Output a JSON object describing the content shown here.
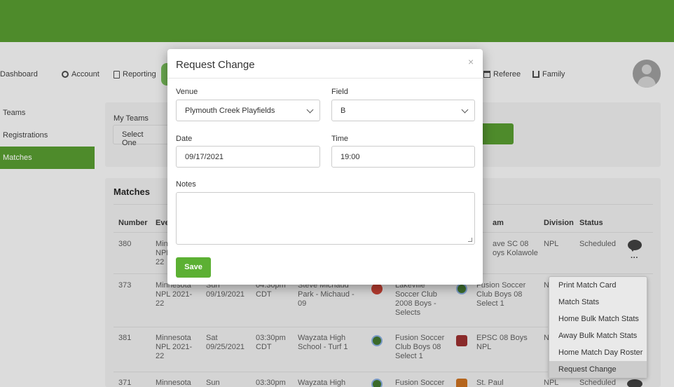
{
  "nav": {
    "dashboard": "Dashboard",
    "account": "Account",
    "reporting": "Reporting",
    "referee": "Referee",
    "family": "Family"
  },
  "sidebar": {
    "items": [
      {
        "label": "Teams"
      },
      {
        "label": "Registrations"
      },
      {
        "label": "Matches"
      }
    ]
  },
  "filters": {
    "my_teams_label": "My Teams",
    "my_teams_value": "Select One"
  },
  "matches": {
    "title": "Matches",
    "headers": [
      "Number",
      "Eve",
      "am",
      "Division",
      "Status"
    ],
    "rows": [
      {
        "number": "380",
        "event": "Min\nNPL\n22",
        "away": "ave SC 08\noys Kolawole",
        "division": "NPL",
        "status": "Scheduled"
      },
      {
        "number": "373",
        "event": "Minnesota\nNPL 2021-\n22",
        "day": "Sun\n09/19/2021",
        "time": "04:30pm\nCDT",
        "venue": "Steve Michaud\nPark - Michaud -\n09",
        "home": "Lakeville\nSoccer Club\n2008 Boys -\nSelects",
        "away": "Fusion Soccer\nClub Boys 08\nSelect 1",
        "division": "N"
      },
      {
        "number": "381",
        "event": "Minnesota\nNPL 2021-\n22",
        "day": "Sat\n09/25/2021",
        "time": "03:30pm\nCDT",
        "venue": "Wayzata High\nSchool - Turf 1",
        "home": "Fusion Soccer\nClub Boys 08\nSelect 1",
        "away": "EPSC 08 Boys\nNPL",
        "division": "N"
      },
      {
        "number": "371",
        "event": "Minnesota",
        "day": "Sun",
        "time": "03:30pm",
        "venue": "Wayzata High",
        "home": "Fusion Soccer",
        "away": "St. Paul",
        "division": "NPL",
        "status": "Scheduled"
      }
    ]
  },
  "row_menu": {
    "items": [
      "Print Match Card",
      "Match Stats",
      "Home Bulk Match Stats",
      "Away Bulk Match Stats",
      "Home Match Day Roster",
      "Request Change"
    ]
  },
  "modal": {
    "title": "Request Change",
    "close": "×",
    "venue_label": "Venue",
    "venue_value": "Plymouth Creek Playfields",
    "field_label": "Field",
    "field_value": "B",
    "date_label": "Date",
    "date_value": "09/17/2021",
    "time_label": "Time",
    "time_value": "19:00",
    "notes_label": "Notes",
    "notes_value": "",
    "save_label": "Save"
  },
  "colors": {
    "topbar": "#4e8b2b",
    "save_button": "#5cb033"
  }
}
